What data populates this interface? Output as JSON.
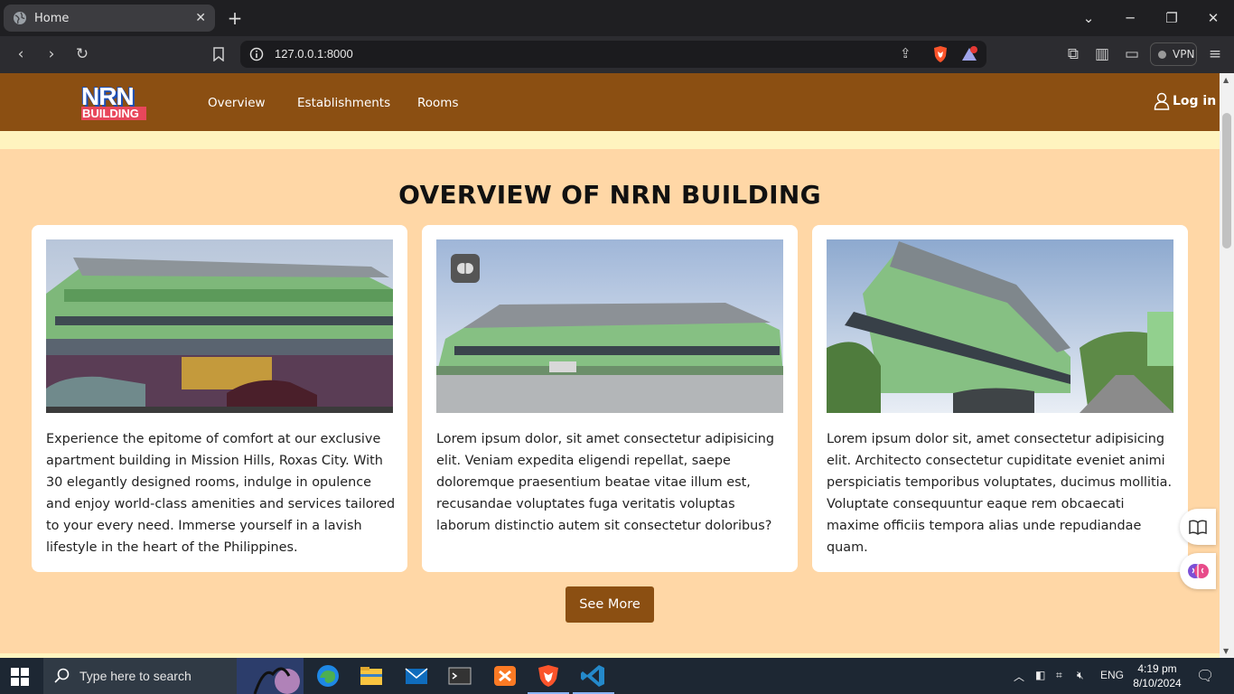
{
  "browser": {
    "tab_title": "Home",
    "url": "127.0.0.1:8000",
    "vpn_label": "VPN",
    "rewards_badge": "1"
  },
  "site": {
    "logo_line1": "NRN",
    "logo_line2": "BUILDING",
    "nav": [
      "Overview",
      "Establishments",
      "Rooms"
    ],
    "login_label": "Log in",
    "heading": "OVERVIEW OF NRN BUILDING",
    "cards": [
      {
        "text": "Experience the epitome of comfort at our exclusive apartment building in Mission Hills, Roxas City. With 30 elegantly designed rooms, indulge in opulence and enjoy world-class amenities and services tailored to your every need. Immerse yourself in a lavish lifestyle in the heart of the Philippines."
      },
      {
        "text": "Lorem ipsum dolor, sit amet consectetur adipisicing elit. Veniam expedita eligendi repellat, saepe doloremque praesentium beatae vitae illum est, recusandae voluptates fuga veritatis voluptas laborum distinctio autem sit consectetur doloribus?"
      },
      {
        "text": "Lorem ipsum dolor sit, amet consectetur adipisicing elit. Architecto consectetur cupiditate eveniet animi perspiciatis temporibus voluptates, ducimus mollitia. Voluptate consequuntur eaque rem obcaecati maxime officiis tempora alias unde repudiandae quam."
      }
    ],
    "see_more_label": "See More"
  },
  "taskbar": {
    "search_placeholder": "Type here to search",
    "language": "ENG",
    "time": "4:19 pm",
    "date": "8/10/2024"
  },
  "colors": {
    "nav_brown": "#8b4f12",
    "page_peach": "#ffd7a6",
    "strip_cream": "#fff4bf"
  }
}
